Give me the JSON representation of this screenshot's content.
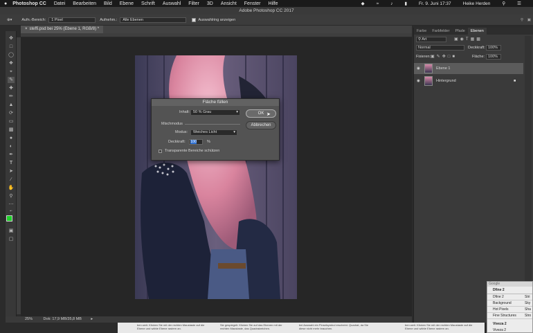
{
  "menubar": {
    "app": "Photoshop CC",
    "items": [
      "Datei",
      "Bearbeiten",
      "Bild",
      "Ebene",
      "Schrift",
      "Auswahl",
      "Filter",
      "3D",
      "Ansicht",
      "Fenster",
      "Hilfe"
    ],
    "clock": "Fr. 9. Juni  17:37",
    "user": "Heike Herden"
  },
  "titlebar": {
    "title": "Adobe Photoshop CC 2017"
  },
  "options": {
    "sample_label": "Aufn.-Bereich:",
    "sample_value": "1 Pixel",
    "sample2_label": "Aufnehm.:",
    "sample2_value": "Alle Ebenen",
    "ring_label": "Auswahlring anzeigen"
  },
  "document": {
    "tab": "steffi.psd bei 25% (Ebene 1, RGB/8) *",
    "zoom": "25%",
    "doc_info": "Dok: 17,9 MB/35,8 MB"
  },
  "layers_panel": {
    "tabs": [
      "Farbe",
      "Farbfelder",
      "Pfade",
      "Ebenen"
    ],
    "active_tab": "Ebenen",
    "search": "Art",
    "blend": "Normal",
    "opacity_label": "Deckkraft:",
    "opacity": "100%",
    "lock_label": "Fixieren:",
    "fill_label": "Fläche:",
    "fill": "100%",
    "layers": [
      "Ebene 1",
      "Hintergrund"
    ]
  },
  "dialog": {
    "title": "Fläche füllen",
    "content_label": "Inhalt:",
    "content_value": "50 % Grau",
    "ok": "OK",
    "cancel": "Abbrechen",
    "blend_section": "Mischmodus",
    "mode_label": "Modus:",
    "mode_value": "Weiches Licht",
    "opacity_label": "Deckkraft:",
    "opacity_value": "100",
    "percent": "%",
    "preserve_label": "Transparente Bereiche schützen"
  },
  "popup": {
    "title": "Google",
    "header": "Dfine 2",
    "rows": [
      [
        "Dfine 2",
        "Stri"
      ],
      [
        "Background",
        "Sky"
      ],
      [
        "Hot Pixels",
        "Sha"
      ],
      [
        "Fine Structures",
        "Stro"
      ]
    ],
    "footer": "Viveza 2",
    "footer2": "Viveza 2"
  },
  "bottom_text": {
    "c1": "ben weit. Klicken Sie mit der rechten Maustaste auf die Ebene und wähle Ebene rastern an.",
    "c2": "Sie gespiegelt. Klicken Sie auf das Ebenen mit der rechten Maustaste, das Quadratzeichen.",
    "c3": "bei Auswahl ein Pinselsymbol erscheint. Quadrat, da Sie diese nicht mehr brauchen.",
    "c4": "ben weit. Klicken Sie mit der rechten Maustaste auf die Ebene und wähle Ebene rastern an."
  }
}
